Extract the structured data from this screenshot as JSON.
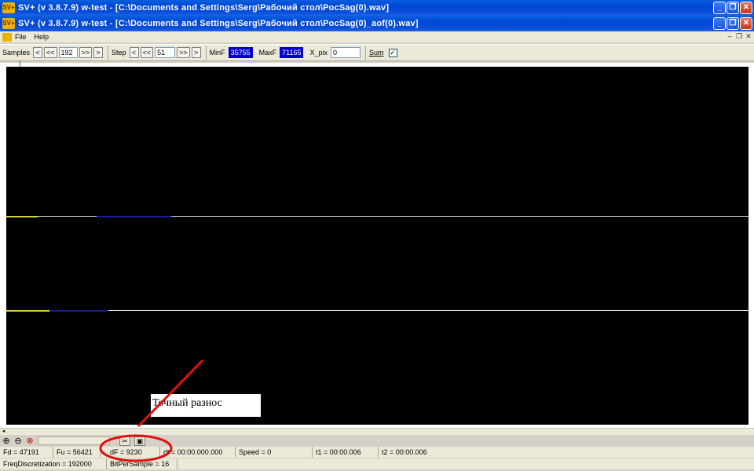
{
  "windows": {
    "outer_title": "SV+  (v 3.8.7.9) w-test  - [C:\\Documents and Settings\\Serg\\Рабочий стол\\PocSag(0).wav]",
    "inner_title": "SV+  (v 3.8.7.9) w-test  - [C:\\Documents and Settings\\Serg\\Рабочий стол\\PocSag(0)_aof(0).wav]",
    "logo_text": "SV+"
  },
  "menu": {
    "file": "File",
    "help": "Help"
  },
  "toolbar": {
    "samples_label": "Samples",
    "samples_value": "192",
    "step_label": "Step",
    "step_value": "51",
    "minf_label": "MinF",
    "minf_value": "35755",
    "maxf_label": "MaxF",
    "maxf_value": "71165",
    "xpix_label": "X_pix",
    "xpix_value": "0",
    "sum_label": "Sum",
    "sum_checked": "✓",
    "btn_prev": "<",
    "btn_prev_fast": "<<",
    "btn_next_fast": ">>",
    "btn_next": ">"
  },
  "annotation": {
    "text": "Точный разнос"
  },
  "status": {
    "fd": "Fd = 47191",
    "fu": "Fu = 56421",
    "df": "dF = 9230",
    "dt": "dt = 00:00.000.000",
    "speed": "Speed = 0",
    "t1": "t1 = 00:00.006",
    "t2": "t2 = 00:00.006",
    "freq_discretization": "FreqDiscretization = 192000",
    "bits_per_sample": "BitPerSample = 16"
  },
  "colors": {
    "title_bar": "#0046d5",
    "plot_bg": "#000000",
    "value_box": "#0000c8",
    "annotation_stroke": "#e01010"
  }
}
